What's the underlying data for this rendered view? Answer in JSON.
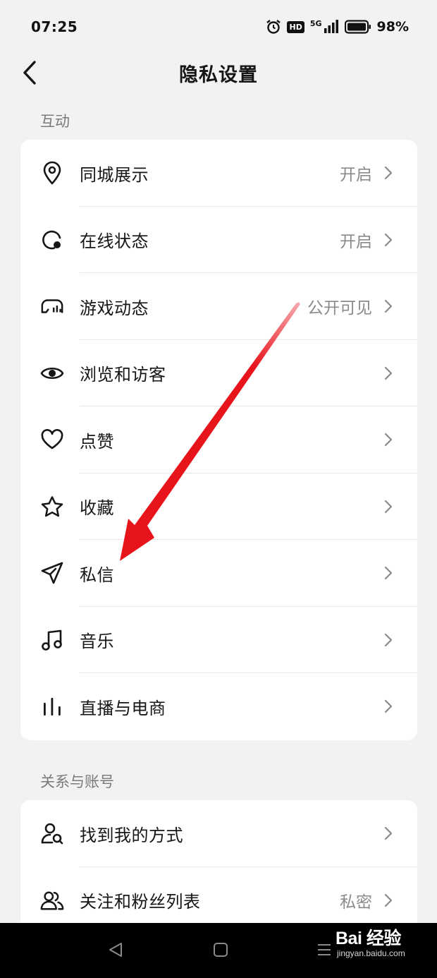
{
  "status_bar": {
    "time": "07:25",
    "hd": "HD",
    "network": "5G",
    "battery": "98%"
  },
  "header": {
    "title": "隐私设置"
  },
  "sections": [
    {
      "title": "互动",
      "items": [
        {
          "label": "同城展示",
          "value": "开启",
          "icon": "location-pin-icon"
        },
        {
          "label": "在线状态",
          "value": "开启",
          "icon": "online-status-icon"
        },
        {
          "label": "游戏动态",
          "value": "公开可见",
          "icon": "game-controller-icon"
        },
        {
          "label": "浏览和访客",
          "value": "",
          "icon": "eye-icon"
        },
        {
          "label": "点赞",
          "value": "",
          "icon": "heart-icon"
        },
        {
          "label": "收藏",
          "value": "",
          "icon": "star-icon"
        },
        {
          "label": "私信",
          "value": "",
          "icon": "paper-plane-icon"
        },
        {
          "label": "音乐",
          "value": "",
          "icon": "music-note-icon"
        },
        {
          "label": "直播与电商",
          "value": "",
          "icon": "live-bars-icon"
        }
      ]
    },
    {
      "title": "关系与账号",
      "items": [
        {
          "label": "找到我的方式",
          "value": "",
          "icon": "user-search-icon"
        },
        {
          "label": "关注和粉丝列表",
          "value": "私密",
          "icon": "users-icon"
        }
      ]
    }
  ],
  "watermark": {
    "main": "Bai 经验",
    "sub": "jingyan.baidu.com"
  },
  "colors": {
    "background": "#f2f2f2",
    "card": "#ffffff",
    "arrow": "#e8141c",
    "secondary_text": "#8a8a8a"
  }
}
